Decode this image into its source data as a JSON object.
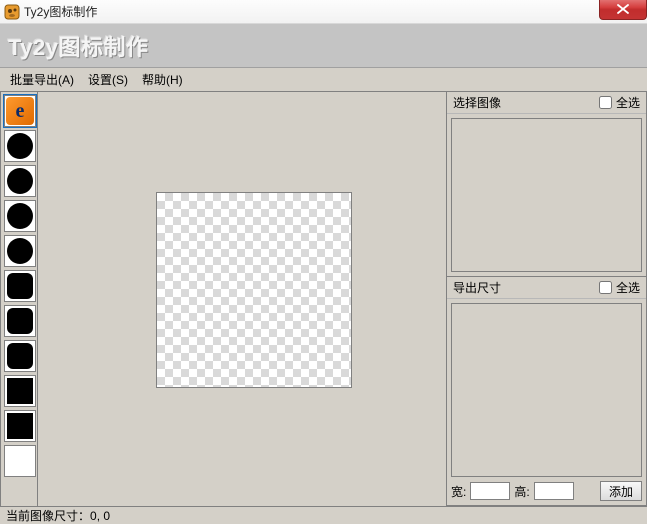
{
  "window": {
    "title": "Ty2y图标制作"
  },
  "banner": {
    "text": "Ty2y图标制作"
  },
  "menu": {
    "batch_export": "批量导出(A)",
    "settings": "设置(S)",
    "help": "帮助(H)"
  },
  "left_thumbs": [
    {
      "kind": "e-icon",
      "selected": true
    },
    {
      "kind": "circle"
    },
    {
      "kind": "circle"
    },
    {
      "kind": "circle"
    },
    {
      "kind": "circle"
    },
    {
      "kind": "rsquare"
    },
    {
      "kind": "rsquare"
    },
    {
      "kind": "rsquare"
    },
    {
      "kind": "square"
    },
    {
      "kind": "square"
    },
    {
      "kind": "empty"
    }
  ],
  "right": {
    "select_image_label": "选择图像",
    "select_all_label": "全选",
    "export_size_label": "导出尺寸",
    "width_label": "宽:",
    "height_label": "高:",
    "add_label": "添加"
  },
  "status": {
    "prefix": "当前图像尺寸：",
    "value": "0, 0"
  }
}
